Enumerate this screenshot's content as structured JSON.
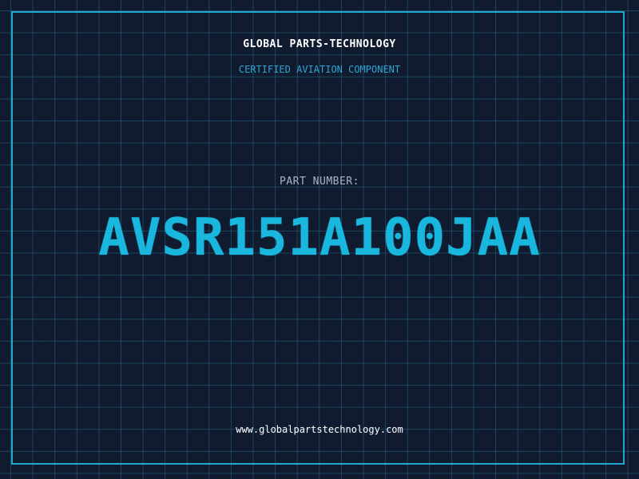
{
  "label": {
    "company": "GLOBAL PARTS-TECHNOLOGY",
    "subtitle": "CERTIFIED AVIATION COMPONENT",
    "part_number_label": "PART NUMBER:",
    "part_number": "AVSR151A100JAA",
    "website": "www.globalpartstechnology.com"
  },
  "colors": {
    "background": "#101b30",
    "grid": "#2a7896",
    "frame": "#22a7cf",
    "accent": "#19b6de",
    "text_primary": "#ffffff",
    "text_muted": "#a9b4c2"
  }
}
